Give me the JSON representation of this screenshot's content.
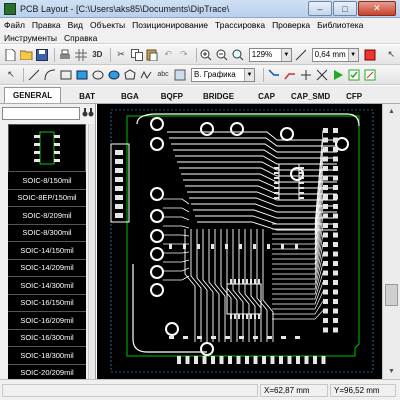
{
  "window": {
    "title": "PCB Layout - [C:\\Users\\aks85\\Documents\\DipTrace\\",
    "minimize": "–",
    "maximize": "□",
    "close": "✕"
  },
  "menu": {
    "row1": [
      "Файл",
      "Правка",
      "Вид",
      "Объекты",
      "Позиционирование",
      "Трассировка",
      "Проверка",
      "Библиотека"
    ],
    "row2": [
      "Инструменты",
      "Справка"
    ]
  },
  "toolbar1": {
    "view_3d": "3D",
    "zoom_value": "129%",
    "width_value": "0,64 mm"
  },
  "toolbar2": {
    "text_tool": "abc",
    "layer_value": "В. Графика"
  },
  "library_tabs": [
    "GENERAL",
    "BAT",
    "BGA",
    "BQFP",
    "BRIDGE",
    "CAP",
    "CAP_SMD",
    "CFP"
  ],
  "active_tab": "GENERAL",
  "components": [
    "SOIC-8/150mil",
    "SOIC-8EP/150mil",
    "SOIC-8/209mil",
    "SOIC-8/300mil",
    "SOIC-14/150mil",
    "SOIC-14/209mil",
    "SOIC-14/300mil",
    "SOIC-16/150mil",
    "SOIC-16/209mil",
    "SOIC-16/300mil",
    "SOIC-18/300mil",
    "SOIC-20/209mil",
    "SOIC-20/300mil"
  ],
  "status": {
    "x": "X=62,87 mm",
    "y": "Y=96,52 mm"
  },
  "colors": {
    "canvas_bg": "#000000",
    "trace": "#ffffff",
    "board_outline": "#00c000",
    "pad": "#e6e6e6",
    "selection": "#3cb4ff"
  },
  "icons": [
    "new-icon",
    "open-icon",
    "save-icon",
    "print-icon",
    "cut-icon",
    "copy-icon",
    "paste-icon",
    "undo-icon",
    "redo-icon",
    "zoom-in-icon",
    "zoom-out-icon",
    "zoom-fit-icon",
    "pointer-icon",
    "line-icon",
    "arc-icon",
    "rectangle-icon",
    "ellipse-icon",
    "polygon-icon",
    "route-icon",
    "run-icon",
    "filter-icon"
  ]
}
